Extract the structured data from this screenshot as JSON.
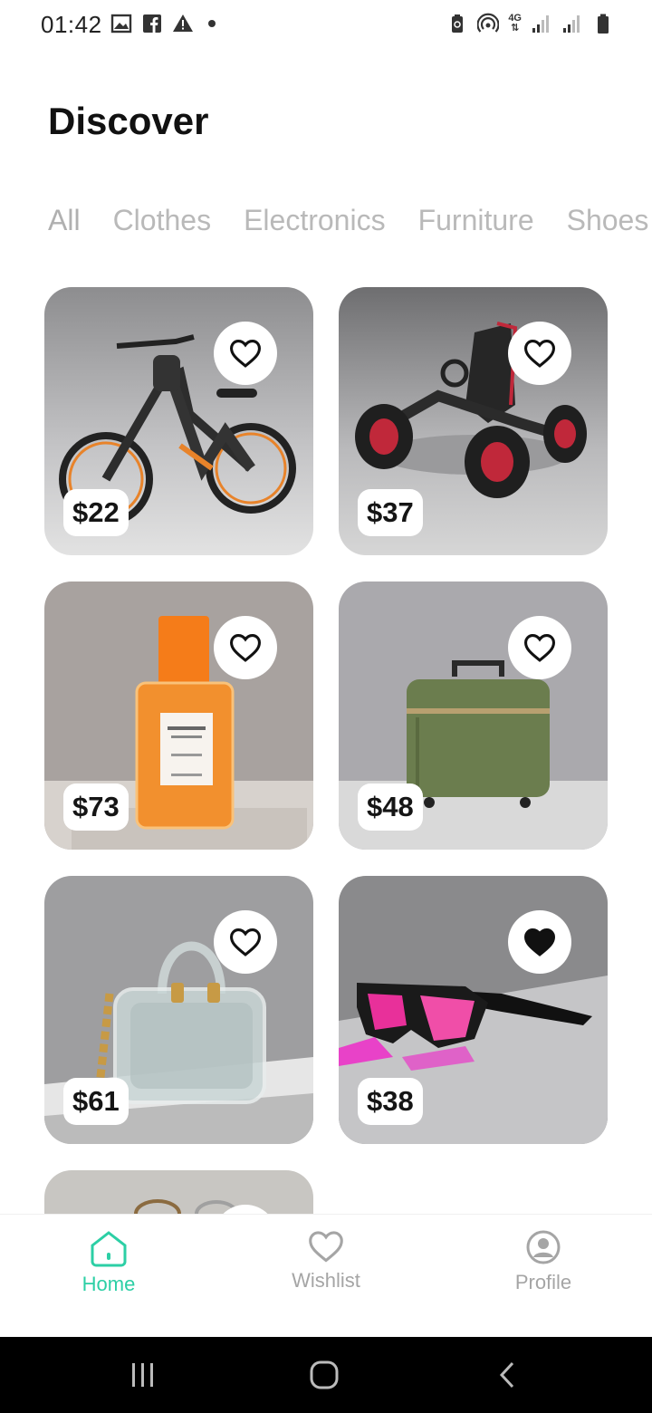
{
  "status_bar": {
    "time": "01:42",
    "left_icons": [
      "image-icon",
      "facebook-icon",
      "warning-icon",
      "dot-icon"
    ],
    "right_icons": [
      "battery-saver-icon",
      "hotspot-icon",
      "network-4g-icon",
      "signal-icon",
      "signal-icon",
      "battery-icon"
    ],
    "network_label": "4G"
  },
  "header": {
    "title": "Discover"
  },
  "tabs": [
    {
      "label": "All",
      "active": true
    },
    {
      "label": "Clothes",
      "active": false
    },
    {
      "label": "Electronics",
      "active": false
    },
    {
      "label": "Furniture",
      "active": false
    },
    {
      "label": "Shoes",
      "active": false
    }
  ],
  "products": [
    {
      "name": "electric-bike",
      "price": "$22",
      "favorited": false
    },
    {
      "name": "go-kart",
      "price": "$37",
      "favorited": false
    },
    {
      "name": "perfume",
      "price": "$73",
      "favorited": false
    },
    {
      "name": "suitcase",
      "price": "$48",
      "favorited": false
    },
    {
      "name": "handbag",
      "price": "$61",
      "favorited": false
    },
    {
      "name": "sunglasses",
      "price": "$38",
      "favorited": true
    },
    {
      "name": "glasses",
      "price": "",
      "favorited": false
    }
  ],
  "bottom_nav": {
    "items": [
      {
        "label": "Home",
        "icon": "home-icon",
        "active": true
      },
      {
        "label": "Wishlist",
        "icon": "heart-icon",
        "active": false
      },
      {
        "label": "Profile",
        "icon": "profile-icon",
        "active": false
      }
    ],
    "active_color": "#2ccfa5",
    "inactive_color": "#a5a5a5"
  },
  "android_nav": {
    "buttons": [
      "recent-apps-icon",
      "home-circle-icon",
      "back-icon"
    ]
  }
}
